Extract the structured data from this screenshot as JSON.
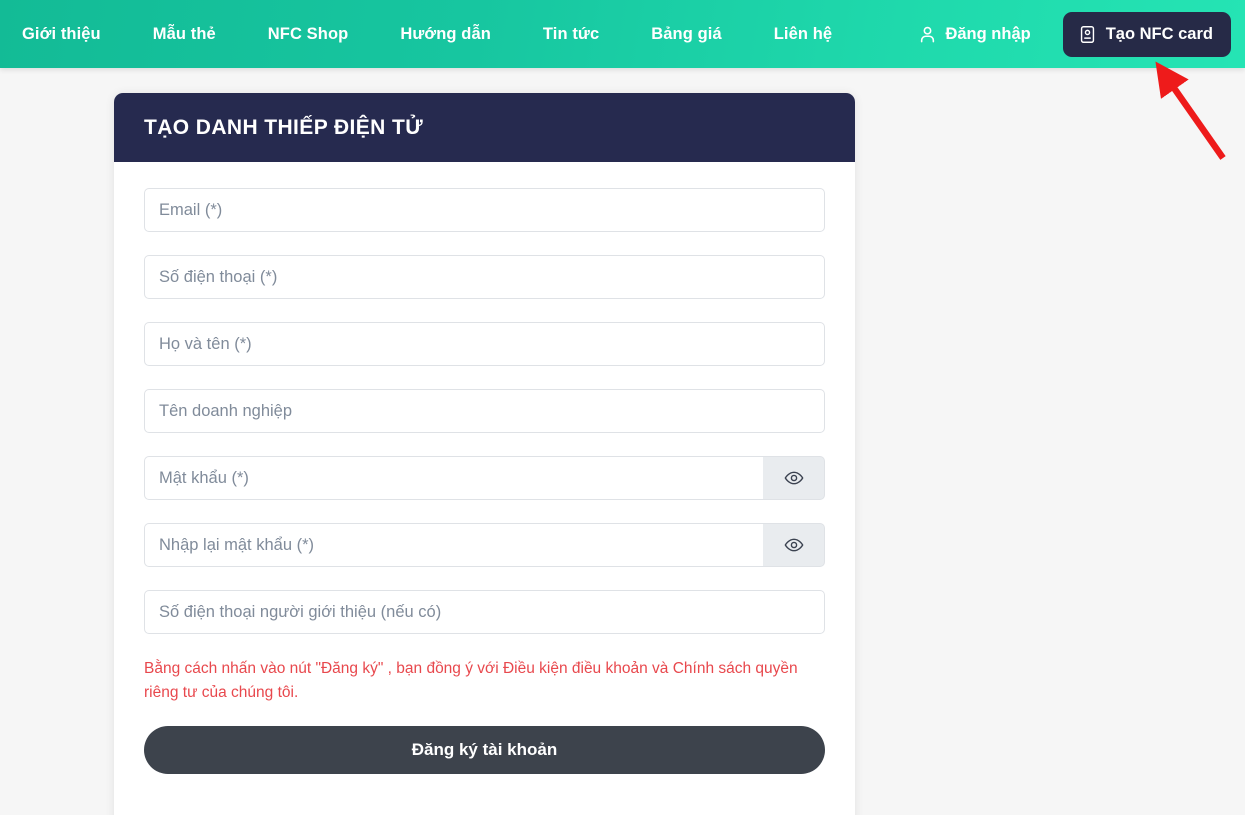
{
  "brand": {
    "navbar_gradient_from": "#13bb96",
    "navbar_gradient_to": "#25e4b4",
    "card_header_bg": "#262a4f",
    "accent_dark": "#262a47",
    "warning_color": "#e8484d",
    "submit_bg": "#3d434c",
    "page_bg": "#f6f6f6",
    "annotation_arrow_color": "#ee1b1b"
  },
  "navbar": {
    "items": [
      {
        "label": "Giới thiệu",
        "name": "nav-item-gioi-thieu"
      },
      {
        "label": "Mẫu thẻ",
        "name": "nav-item-mau-the"
      },
      {
        "label": "NFC Shop",
        "name": "nav-item-nfc-shop"
      },
      {
        "label": "Hướng dẫn",
        "name": "nav-item-huong-dan"
      },
      {
        "label": "Tin tức",
        "name": "nav-item-tin-tuc"
      },
      {
        "label": "Bảng giá",
        "name": "nav-item-bang-gia"
      },
      {
        "label": "Liên hệ",
        "name": "nav-item-lien-he"
      }
    ],
    "login_label": "Đăng nhập",
    "login_icon": "user-icon",
    "cta_label": "Tạo NFC card",
    "cta_icon": "nfc-card-icon"
  },
  "annotation": {
    "type": "arrow",
    "points_to": "Tạo NFC card",
    "color": "#ee1b1b"
  },
  "card": {
    "title": "TẠO DANH THIẾP ĐIỆN TỬ",
    "fields": [
      {
        "name": "email-field",
        "placeholder": "Email (*)",
        "value": "",
        "type": "text",
        "toggle": false
      },
      {
        "name": "phone-field",
        "placeholder": "Số điện thoại (*)",
        "value": "",
        "type": "text",
        "toggle": false
      },
      {
        "name": "fullname-field",
        "placeholder": "Họ và tên (*)",
        "value": "",
        "type": "text",
        "toggle": false
      },
      {
        "name": "company-field",
        "placeholder": "Tên doanh nghiệp",
        "value": "",
        "type": "text",
        "toggle": false
      },
      {
        "name": "password-field",
        "placeholder": "Mật khẩu (*)",
        "value": "",
        "type": "password",
        "toggle": true
      },
      {
        "name": "confirm-password-field",
        "placeholder": "Nhập lại mật khẩu (*)",
        "value": "",
        "type": "password",
        "toggle": true
      },
      {
        "name": "referrer-phone-field",
        "placeholder": "Số điện thoại người giới thiệu (nếu có)",
        "value": "",
        "type": "text",
        "toggle": false
      }
    ],
    "toggle_icon": "eye-icon",
    "terms_note": "Bằng cách nhấn vào nút \"Đăng ký\" , bạn đồng ý với Điều kiện điều khoản và Chính sách quyền riêng tư của chúng tôi.",
    "submit_label": "Đăng ký tài khoản"
  }
}
